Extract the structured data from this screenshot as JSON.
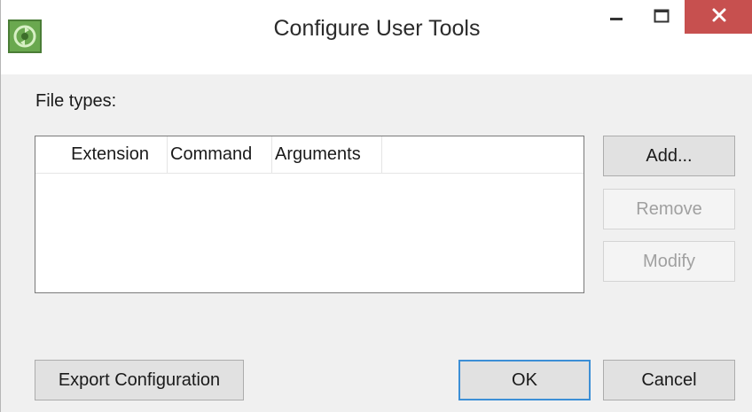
{
  "window": {
    "title": "Configure User Tools",
    "icon": "recycle-green-icon",
    "controls": {
      "minimize_icon": "minimize-icon",
      "maximize_icon": "maximize-icon",
      "close_icon": "close-icon"
    }
  },
  "file_types": {
    "label": "File types:",
    "columns": [
      "Extension",
      "Command",
      "Arguments"
    ],
    "rows": []
  },
  "side_buttons": {
    "add": "Add...",
    "remove": "Remove",
    "modify": "Modify"
  },
  "footer": {
    "export": "Export Configuration",
    "ok": "OK",
    "cancel": "Cancel"
  },
  "colors": {
    "close_button": "#c7504f",
    "default_button_border": "#3c8fd6",
    "disabled_text": "#a0a0a0"
  }
}
